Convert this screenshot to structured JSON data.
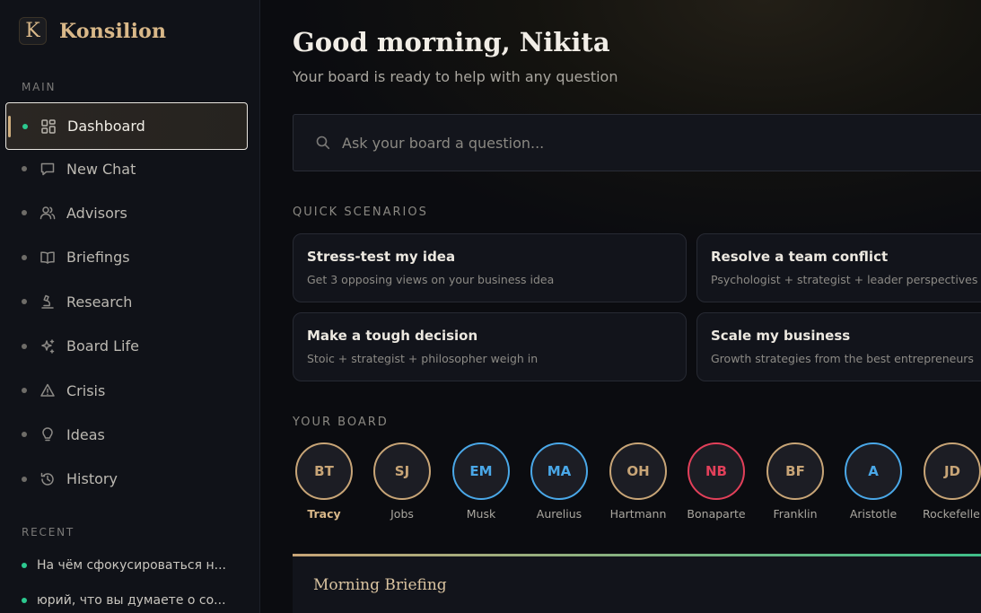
{
  "brand": {
    "logo_letter": "K",
    "name": "Konsilion"
  },
  "sidebar": {
    "main_label": "MAIN",
    "items": [
      {
        "label": "Dashboard",
        "icon": "grid-icon",
        "active": true
      },
      {
        "label": "New Chat",
        "icon": "chat-icon"
      },
      {
        "label": "Advisors",
        "icon": "users-icon"
      },
      {
        "label": "Briefings",
        "icon": "book-icon"
      },
      {
        "label": "Research",
        "icon": "microscope-icon"
      },
      {
        "label": "Board Life",
        "icon": "sparkles-icon"
      },
      {
        "label": "Crisis",
        "icon": "warning-icon"
      },
      {
        "label": "Ideas",
        "icon": "lightbulb-icon"
      },
      {
        "label": "History",
        "icon": "history-icon"
      }
    ],
    "recent_label": "RECENT",
    "recent": [
      "На чём сфокусироваться н...",
      "юрий, что вы думаете о со..."
    ]
  },
  "main": {
    "greeting": "Good morning, Nikita",
    "subtitle": "Your board is ready to help with any question",
    "search": {
      "placeholder": "Ask your board a question..."
    },
    "scenarios_label": "QUICK SCENARIOS",
    "scenarios": [
      {
        "title": "Stress-test my idea",
        "desc": "Get 3 opposing views on your business idea"
      },
      {
        "title": "Resolve a team conflict",
        "desc": "Psychologist + strategist + leader perspectives"
      },
      {
        "title": "Make a tough decision",
        "desc": "Stoic + strategist + philosopher weigh in"
      },
      {
        "title": "Scale my business",
        "desc": "Growth strategies from the best entrepreneurs"
      }
    ],
    "board_label": "YOUR BOARD",
    "board": [
      {
        "initials": "BT",
        "name": "Tracy",
        "color": "#c8a577",
        "active": true
      },
      {
        "initials": "SJ",
        "name": "Jobs",
        "color": "#c8a577"
      },
      {
        "initials": "EM",
        "name": "Musk",
        "color": "#4aa8e8"
      },
      {
        "initials": "MA",
        "name": "Aurelius",
        "color": "#4aa8e8"
      },
      {
        "initials": "OH",
        "name": "Hartmann",
        "color": "#c8a577"
      },
      {
        "initials": "NB",
        "name": "Bonaparte",
        "color": "#e2405a"
      },
      {
        "initials": "BF",
        "name": "Franklin",
        "color": "#c8a577"
      },
      {
        "initials": "A",
        "name": "Aristotle",
        "color": "#4aa8e8"
      },
      {
        "initials": "JD",
        "name": "Rockefeller",
        "color": "#c8a577"
      }
    ],
    "briefing_title": "Morning Briefing"
  }
}
